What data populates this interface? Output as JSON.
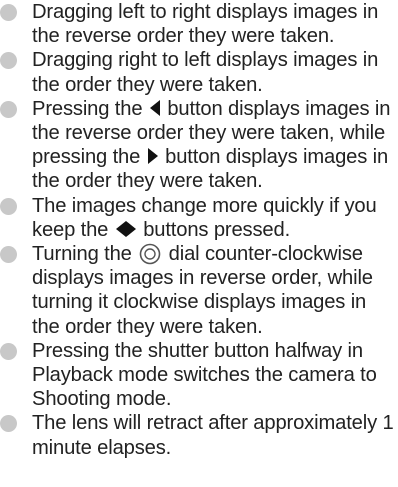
{
  "notes": [
    {
      "text": "Dragging left to right displays images in the reverse order they were taken."
    },
    {
      "text": "Dragging right to left displays images in the order they were taken."
    },
    {
      "before_left": "Pressing the",
      "left_icon": "left-arrow-button-icon",
      "middle": "button displays images in the reverse order they were taken, while pressing the",
      "right_icon": "right-arrow-button-icon",
      "after": "button displays images in the order they were taken."
    },
    {
      "before": "The images change more quickly if you keep the",
      "icon": "left-right-arrow-buttons-icon",
      "after": "buttons pressed."
    },
    {
      "before": "Turning the",
      "icon": "control-dial-icon",
      "after": "dial counter-clockwise displays images in reverse order, while turning it clockwise displays images in the order they were taken."
    },
    {
      "text": "Pressing the shutter button halfway in Playback mode switches the camera to Shooting mode."
    },
    {
      "text": "The lens will retract after approximately 1 minute elapses."
    }
  ],
  "colors": {
    "bullet": "#c8c8c8",
    "text": "#222222",
    "icon": "#111111"
  }
}
